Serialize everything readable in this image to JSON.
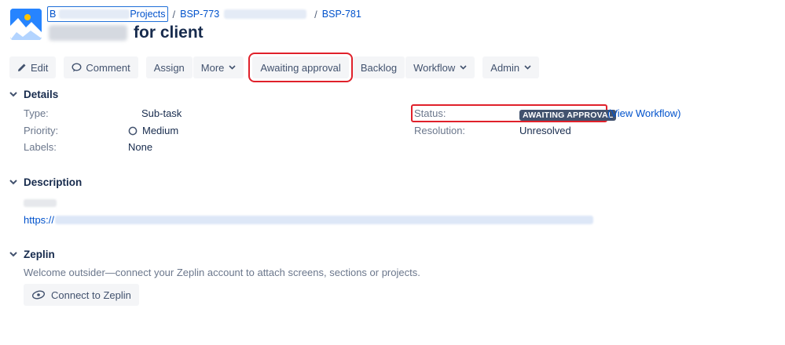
{
  "breadcrumb": {
    "project_link": "Projects",
    "parent_issue": "BSP-773",
    "issue_key": "BSP-781",
    "separator": "/"
  },
  "issue": {
    "title": "for client"
  },
  "toolbar": {
    "edit": "Edit",
    "comment": "Comment",
    "assign": "Assign",
    "more": "More",
    "awaiting_approval": "Awaiting approval",
    "backlog": "Backlog",
    "workflow": "Workflow",
    "admin": "Admin"
  },
  "details": {
    "heading": "Details",
    "type_label": "Type:",
    "type_value": "Sub-task",
    "priority_label": "Priority:",
    "priority_value": "Medium",
    "labels_label": "Labels:",
    "labels_value": "None",
    "status_label": "Status:",
    "status_value": "AWAITING APPROVAL",
    "view_workflow": "(View Workflow)",
    "resolution_label": "Resolution:",
    "resolution_value": "Unresolved"
  },
  "description": {
    "heading": "Description",
    "link_prefix": "https://"
  },
  "zeplin": {
    "heading": "Zeplin",
    "text": "Welcome outsider—connect your Zeplin account to attach screens, sections or projects.",
    "button": "Connect to Zeplin"
  },
  "colors": {
    "accent": "#0052cc",
    "lozenge_bg": "#42526e",
    "highlight": "#e0212b"
  },
  "icons": [
    "project-avatar-icon",
    "pencil-icon",
    "comment-icon",
    "chevron-down-icon",
    "caret-down-icon",
    "priority-medium-icon",
    "zeplin-icon"
  ]
}
